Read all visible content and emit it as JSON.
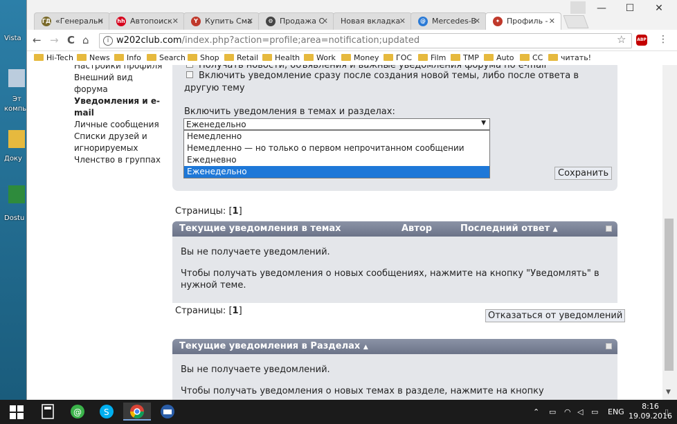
{
  "desktop": {
    "labels": [
      "Vista",
      "Эт",
      "компь",
      "Доку",
      "Dostu"
    ]
  },
  "tabs": [
    {
      "label": "«Генеральн",
      "fav": "ГД",
      "favColor": "#7a6a2a"
    },
    {
      "label": "Автопоиск",
      "fav": "hh",
      "favColor": "#d6001c"
    },
    {
      "label": "Купить Сма",
      "fav": "Y",
      "favColor": "#c0392b"
    },
    {
      "label": "Продажа С",
      "fav": "⚙",
      "favColor": "#444"
    },
    {
      "label": "Новая вкладка",
      "fav": "",
      "favColor": "#ffffff"
    },
    {
      "label": "Mercedes-B",
      "fav": "@",
      "favColor": "#2a7ad6"
    },
    {
      "label": "Профиль -",
      "fav": "✦",
      "favColor": "#c0392b"
    }
  ],
  "window_controls": {
    "minimize": "—",
    "maximize": "☐",
    "close": "✕"
  },
  "toolbar": {
    "back": "←",
    "forward": "→",
    "reload": "C",
    "home": "⌂",
    "url_host": "w202club.com",
    "url_path": "/index.php?action=profile;area=notification;updated",
    "info": "i",
    "star": "☆",
    "abp": "ABP",
    "menu": "⋮"
  },
  "bookmarks": [
    "Hi-Tech",
    "News",
    "Info",
    "Search",
    "Shop",
    "Retail",
    "Health",
    "Work",
    "Money",
    "ГОС",
    "Film",
    "TMP",
    "Auto",
    "CC",
    "читать!"
  ],
  "sidemenu": {
    "items": [
      {
        "label": "Настройки профиля",
        "active": false
      },
      {
        "label": "Внешний вид форума",
        "active": false
      },
      {
        "label": "Уведомления и e-",
        "active": true
      },
      {
        "label": "mail",
        "active": true
      },
      {
        "label": "Личные сообщения",
        "active": false
      },
      {
        "label": "Списки друзей и",
        "active": false
      },
      {
        "label": "игнорируемых",
        "active": false
      },
      {
        "label": "Членство в группах",
        "active": false
      }
    ]
  },
  "form": {
    "cb_partial": "Получать новости, объявления и важные уведомления форума по e-mail",
    "cb_notify_line1": "Включить уведомление сразу после создания новой темы, либо после ответа в",
    "cb_notify_line2": "другую тему",
    "select_label": "Включить уведомления в темах и разделах:",
    "select_value": "Еженедельно",
    "options": [
      "Немедленно",
      "Немедленно — но только о первом непрочитанном сообщении",
      "Ежедневно",
      "Еженедельно"
    ],
    "selected_index": 3,
    "save_label": "Сохранить"
  },
  "pager": {
    "label": "Страницы:",
    "current": "1"
  },
  "topics_panel": {
    "col_topic": "Текущие уведомления в темах",
    "col_author": "Автор",
    "col_last": "Последний ответ",
    "empty": "Вы не получаете уведомлений.",
    "hint": "Чтобы получать уведомления о новых сообщениях, нажмите на кнопку \"Уведомлять\" в нужной теме."
  },
  "unsubscribe_label": "Отказаться от уведомлений",
  "boards_panel": {
    "title": "Текущие уведомления в Разделах",
    "empty": "Вы не получаете уведомлений.",
    "hint": "Чтобы получать уведомления о новых темах в разделе, нажмите на кнопку"
  },
  "taskbar": {
    "lang": "ENG",
    "time": "8:16",
    "date": "19.09.2016"
  }
}
